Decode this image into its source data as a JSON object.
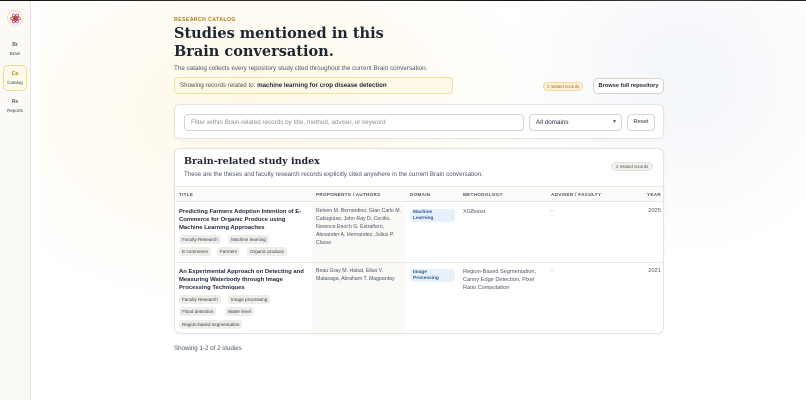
{
  "sidebar": {
    "items": [
      {
        "abbr": "Br",
        "label": "Brain"
      },
      {
        "abbr": "Ca",
        "label": "Catalog"
      },
      {
        "abbr": "Re",
        "label": "Reports"
      }
    ]
  },
  "header": {
    "eyebrow": "RESEARCH CATALOG",
    "title": "Studies mentioned in this Brain conversation.",
    "subtitle": "The catalog collects every repository study cited throughout the current Brain conversation.",
    "context_prefix": "Showing records related to:",
    "context_topic": "machine learning for crop disease detection",
    "related_badge": "2 related records",
    "browse_button": "Browse full repository"
  },
  "filters": {
    "search_placeholder": "Filter within Brain-related records by title, method, adviser, or keyword",
    "search_value": "",
    "domain_selected": "All domains",
    "reset_label": "Reset"
  },
  "index": {
    "title": "Brain-related study index",
    "description": "These are the theses and faculty research records explicitly cited anywhere in the current Brain conversation.",
    "count_badge": "2 related records",
    "columns": {
      "title": "TITLE",
      "authors": "PROPONENTS / AUTHORS",
      "domain": "DOMAIN",
      "methodology": "METHODOLOGY",
      "adviser": "ADVISER / FACULTY",
      "year": "YEAR"
    },
    "rows": [
      {
        "title": "Predicting Farmers Adoption Intention of E-Commerce for Organic Produce using Machine Learning Approaches",
        "tags": [
          "Faculty Research",
          "Machine learning",
          "E-commerce",
          "Farmers",
          "Organic produce"
        ],
        "authors": "Reiven M. Bernardino, Gian Carlo M. Cabuguias, John Ray D. Cecilio, Norence Enoch G. Estrañero, Alexander A. Hernandez, Julius P. Claour",
        "domain": "Machine Learning",
        "methodology": "XGBoost",
        "adviser": "-",
        "year": "2025"
      },
      {
        "title": "An Experimental Approach on Detecting and Measuring Waterbody through Image Processing Techniques",
        "tags": [
          "Faculty Research",
          "Image processing",
          "Flood detection",
          "Water level",
          "Region-based segmentation"
        ],
        "authors": "Beau Gray M. Habal, Elisa V. Malasaga, Abraham T. Magpantay",
        "domain": "Image Processing",
        "methodology": "Region-Based Segmentation, Canny Edge Detection, Pixel Ratio Computation",
        "adviser": "-",
        "year": "2021"
      }
    ]
  },
  "footer": {
    "showing": "Showing 1-2 of 2 studies"
  },
  "colors": {
    "accent": "#b07a18",
    "context_bg": "#fff9e8",
    "domain_pill_bg": "#e6f0fb",
    "domain_pill_text": "#2f5d8a"
  }
}
